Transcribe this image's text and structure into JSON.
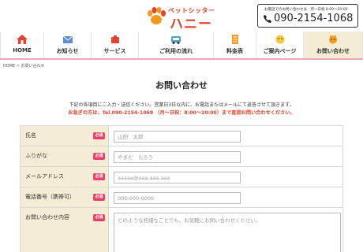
{
  "header": {
    "logo_sub": "ペットシッター",
    "logo_main": "ハニー",
    "tel_note": "お電話でのお問い合わせは　月〜日祝 8:00〜20:00",
    "tel_number": "090-2154-1068"
  },
  "nav": {
    "items": [
      {
        "label": "HOME",
        "icon": "home-icon"
      },
      {
        "label": "お知らせ",
        "icon": "mail-icon"
      },
      {
        "label": "サービス",
        "icon": "service-icon"
      },
      {
        "label": "ご利用の流れ",
        "icon": "flow-icon"
      },
      {
        "label": "料金表",
        "icon": "price-list-icon"
      },
      {
        "label": "ご案内ページ",
        "icon": "guide-icon"
      },
      {
        "label": "お問い合わせ",
        "icon": "contact-icon"
      }
    ],
    "active_index": 6
  },
  "breadcrumb": "HOME > お問い合わせ",
  "page_title": "お問い合わせ",
  "intro_text": "下記の各項目にご入力・送信ください。営業日3日以内に、お電話またはメールにて返答させて頂きます。",
  "urgent_text": "お急ぎの方は、Tel.090-2154-1068 （月〜日祝：8:00〜20:00）まで直接お問い合わせください。",
  "form": {
    "required_label": "必須",
    "fields": [
      {
        "label": "氏名",
        "placeholder": "山田　太郎"
      },
      {
        "label": "ふりがな",
        "placeholder": "やまだ　たろう"
      },
      {
        "label": "メールアドレス",
        "placeholder": "aaaaa@aaa.aaa.aaa"
      },
      {
        "label": "電話番号（携帯可）",
        "placeholder": "000-000-0000"
      },
      {
        "label": "お問い合わせ内容",
        "placeholder": "どのような些細なことでも、お気軽にお問い合わせください。"
      }
    ]
  },
  "colors": {
    "brand_red": "#e8402a",
    "required_pink": "#e8406a",
    "label_bg": "#f4ecd4",
    "nav_border": "#f0a8b8"
  }
}
